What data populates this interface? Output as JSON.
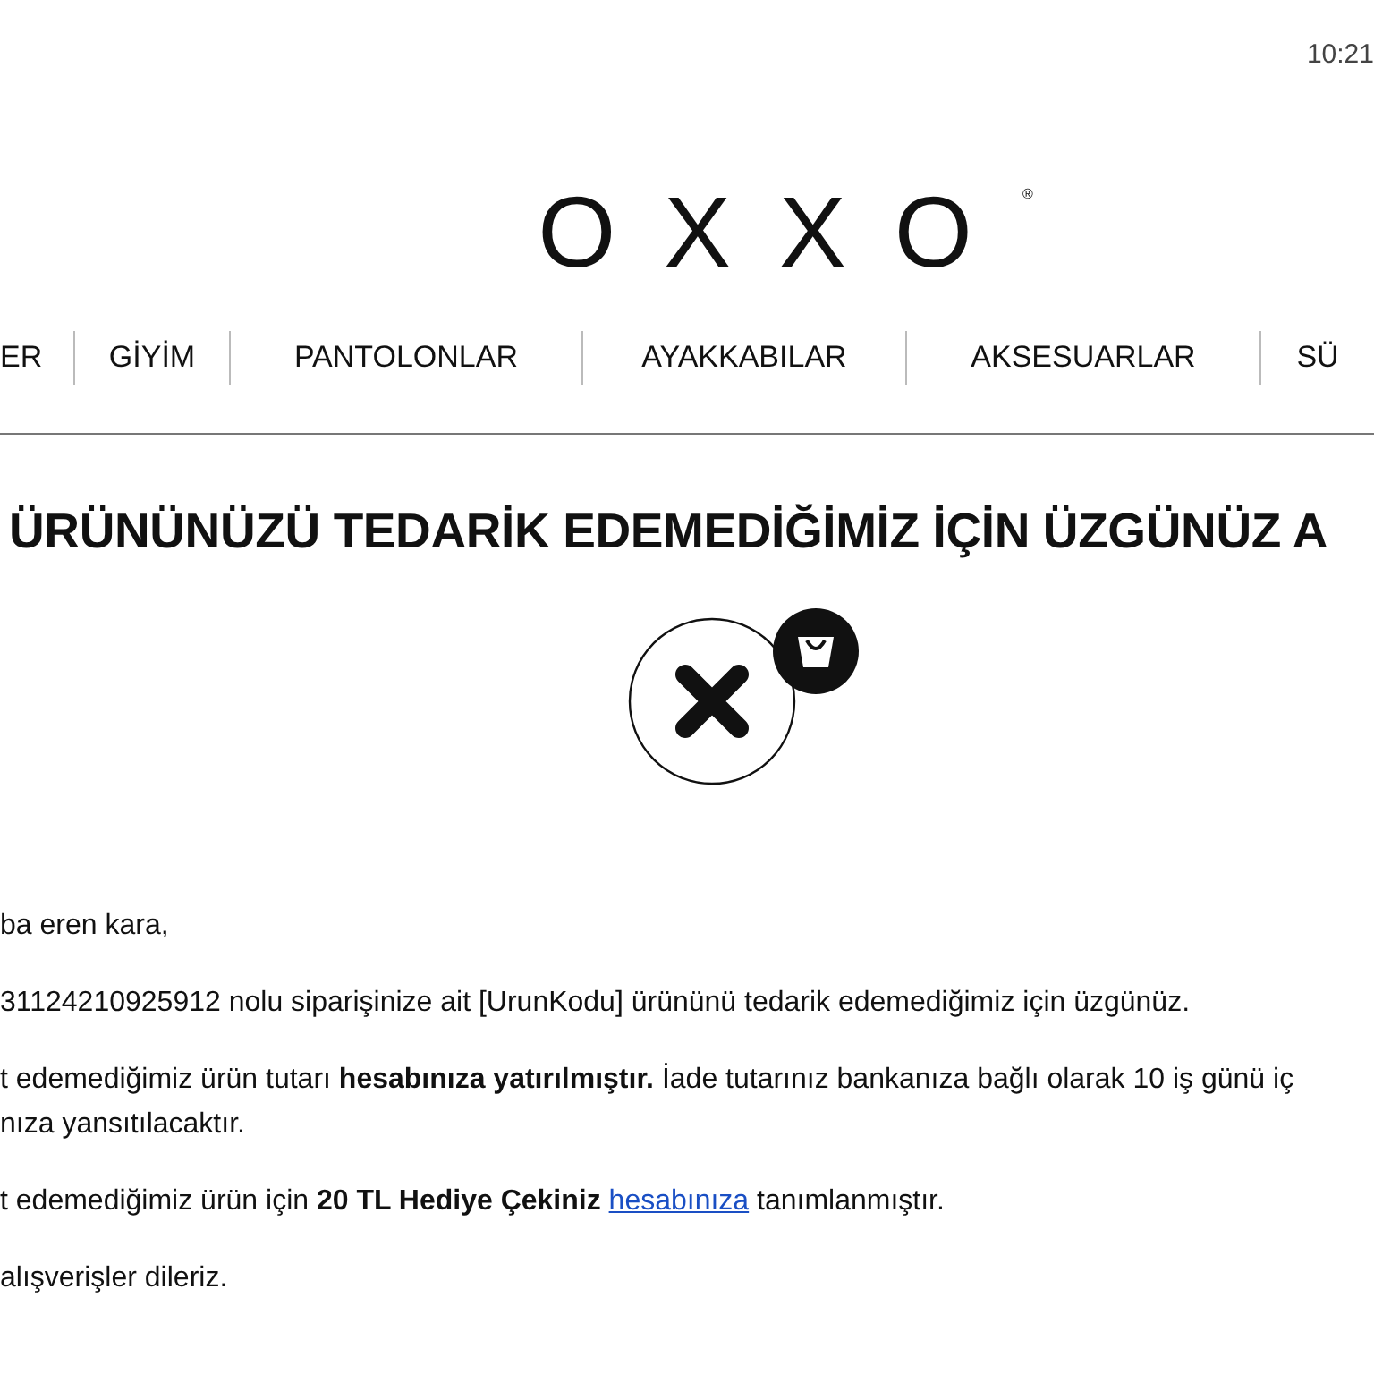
{
  "time": "10:21",
  "logo": {
    "text": "OXXO",
    "mark": "®"
  },
  "nav": [
    {
      "label": "ER"
    },
    {
      "label": "GİYİM"
    },
    {
      "label": "PANTOLONLAR"
    },
    {
      "label": "AYAKKABILAR"
    },
    {
      "label": "AKSESUARLAR"
    },
    {
      "label": "SÜ"
    }
  ],
  "heading": "ÜRÜNÜNÜZÜ TEDARİK EDEMEDİĞİMİZ İÇİN ÜZGÜNÜZ A",
  "paragraphs": [
    {
      "lines": [
        [
          {
            "kind": "text",
            "text": "ba eren kara,"
          }
        ]
      ]
    },
    {
      "lines": [
        [
          {
            "kind": "text",
            "text": "31124210925912 nolu siparişinize ait [UrunKodu] ürününü tedarik edemediğimiz için üzgünüz."
          }
        ]
      ]
    },
    {
      "lines": [
        [
          {
            "kind": "text",
            "text": "t edemediğimiz ürün tutarı **hesabınıza yatırılmıştır.** İade tutarınız bankanıza bağlı olarak 10 iş günü iç"
          }
        ],
        [
          {
            "kind": "text",
            "text": "nıza yansıtılacaktır."
          }
        ]
      ]
    },
    {
      "lines": [
        [
          {
            "kind": "text",
            "text": "t edemediğimiz ürün için **20 TL Hediye Çekiniz** "
          },
          {
            "kind": "link",
            "text": "hesabınıza"
          },
          {
            "kind": "text",
            "text": " tanımlanmıştır."
          }
        ]
      ]
    },
    {
      "lines": [
        [
          {
            "kind": "text",
            "text": "alışverişler dileriz."
          }
        ]
      ]
    }
  ]
}
